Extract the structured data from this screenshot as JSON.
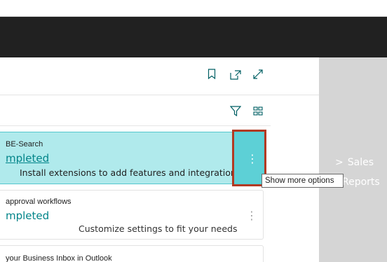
{
  "header_actions": {
    "bookmark_icon": "bookmark-icon",
    "open_new_window_icon": "open-in-new-window-icon",
    "expand_icon": "expand-icon"
  },
  "list_toolbar": {
    "filter_icon": "filter-icon",
    "layout_icon": "tile-layout-icon"
  },
  "rows": [
    {
      "title": "BE-Search",
      "status": "mpleted",
      "description": "Install extensions to add features and integrations",
      "selected": true
    },
    {
      "title": "approval workflows",
      "status": "mpleted",
      "description": "Customize settings to fit your needs",
      "selected": false
    },
    {
      "title": "your Business Inbox in Outlook"
    }
  ],
  "more_options": {
    "glyph": "⋮",
    "tooltip": "Show more options"
  },
  "side_nav": {
    "sales": "Sales",
    "reports": "Reports",
    "chevron": ">"
  },
  "colors": {
    "accent_teal": "#008489",
    "selected_row": "#b0eaec",
    "more_button": "#5dd0d6",
    "highlight_border": "#b33a23",
    "app_bar": "#212121"
  }
}
